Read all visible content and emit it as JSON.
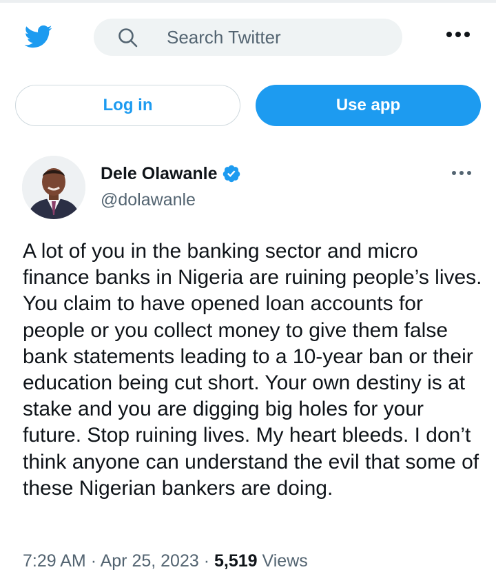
{
  "header": {
    "logo_icon": "twitter-bird-icon",
    "search_placeholder": "Search Twitter",
    "more_icon": "more-horizontal-icon"
  },
  "actions": {
    "login_label": "Log in",
    "use_app_label": "Use app"
  },
  "tweet": {
    "author_name": "Dele Olawanle",
    "handle": "@dolawanle",
    "verified": true,
    "text": "A lot of you in the banking sector and micro finance banks in Nigeria are ruining people’s lives. You claim to have opened loan accounts for people or you collect money to give them false bank statements leading to a 10-year ban or their education being cut short. Your own destiny is at stake and you are digging big holes for your future. Stop ruining lives. My heart bleeds. I don’t think anyone can understand the evil that some of these Nigerian bankers are doing.",
    "time": "7:29 AM",
    "date": "Apr 25, 2023",
    "separator": "·",
    "views_count": "5,519",
    "views_label": "Views"
  },
  "colors": {
    "brand_blue": "#1d9bf0",
    "secondary_text": "#536471",
    "search_bg": "#eff3f4"
  }
}
